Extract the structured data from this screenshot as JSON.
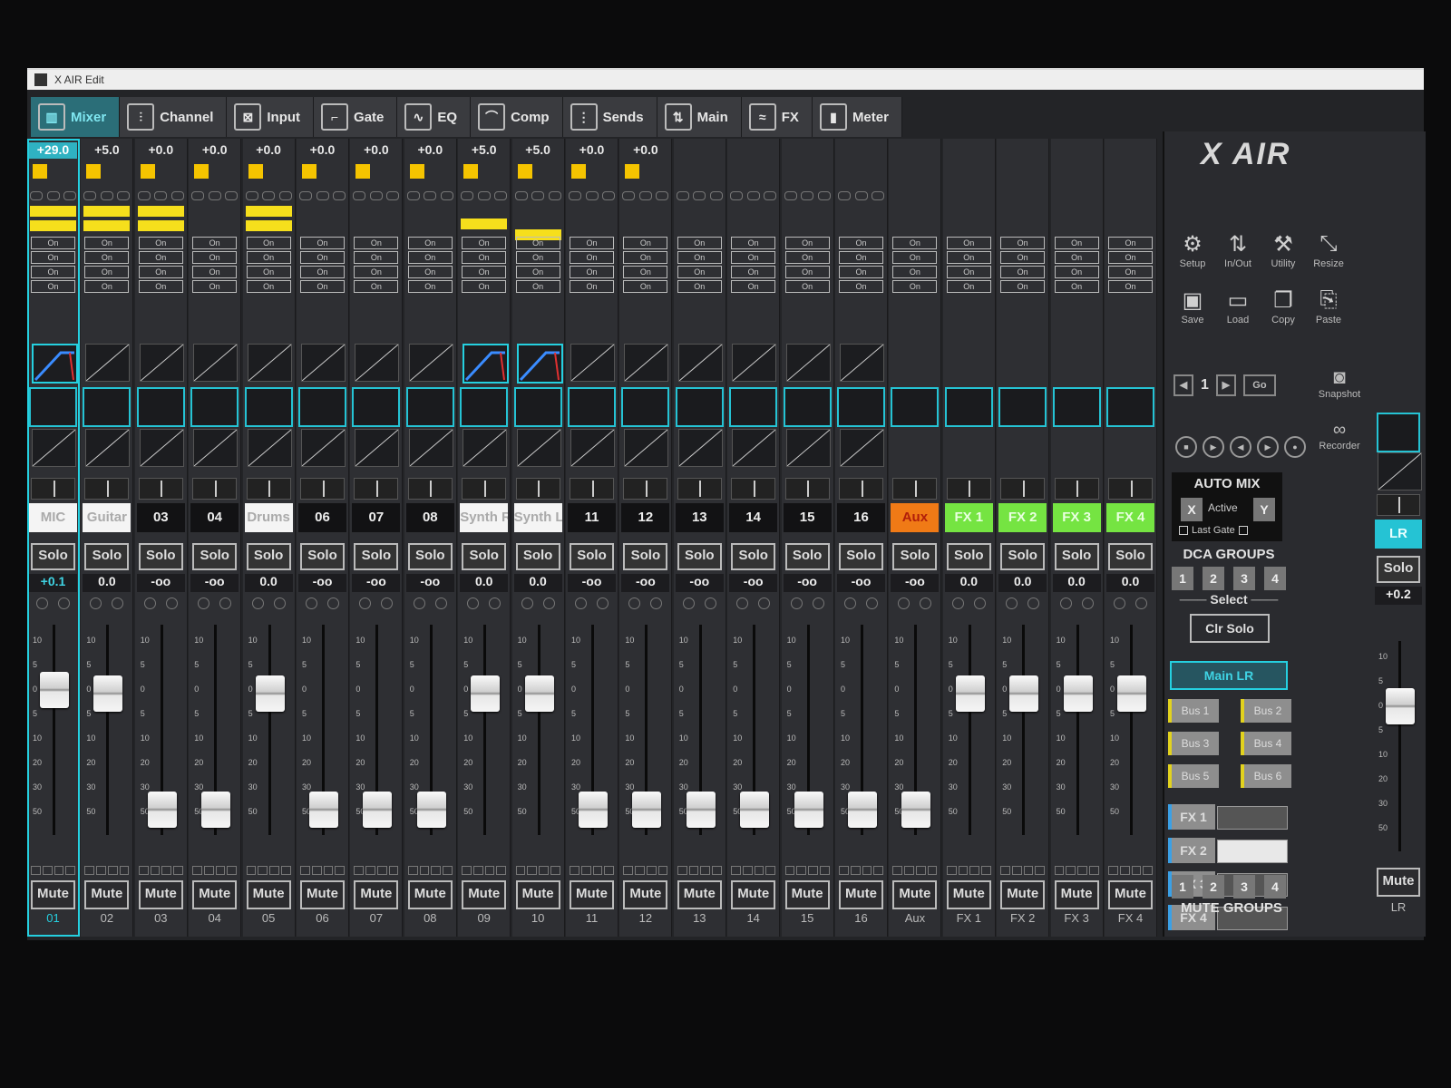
{
  "window": {
    "title": "X AIR Edit"
  },
  "tabs": [
    {
      "label": "Mixer",
      "icon": "mixer-icon",
      "active": true
    },
    {
      "label": "Channel",
      "icon": "channel-icon"
    },
    {
      "label": "Input",
      "icon": "input-icon"
    },
    {
      "label": "Gate",
      "icon": "gate-icon"
    },
    {
      "label": "EQ",
      "icon": "eq-icon"
    },
    {
      "label": "Comp",
      "icon": "comp-icon"
    },
    {
      "label": "Sends",
      "icon": "sends-icon"
    },
    {
      "label": "Main",
      "icon": "main-icon"
    },
    {
      "label": "FX",
      "icon": "fx-icon"
    },
    {
      "label": "Meter",
      "icon": "meter-icon"
    }
  ],
  "on_label": "On",
  "solo_label": "Solo",
  "mute_label": "Mute",
  "scale": [
    "10",
    "5",
    "0",
    "5",
    "10",
    "20",
    "30",
    "50"
  ],
  "channels": [
    {
      "gain": "+29.0",
      "name": "MIC",
      "level": "+0.1",
      "num": "01",
      "fader": 0.74,
      "style": "white",
      "sel": true
    },
    {
      "gain": "+5.0",
      "name": "Guitar",
      "level": "0.0",
      "num": "02",
      "fader": 0.72,
      "style": "white"
    },
    {
      "gain": "+0.0",
      "name": "03",
      "level": "-oo",
      "num": "03",
      "fader": 0.08
    },
    {
      "gain": "+0.0",
      "name": "04",
      "level": "-oo",
      "num": "04",
      "fader": 0.08
    },
    {
      "gain": "+0.0",
      "name": "Drums",
      "level": "0.0",
      "num": "05",
      "fader": 0.72,
      "style": "white"
    },
    {
      "gain": "+0.0",
      "name": "06",
      "level": "-oo",
      "num": "06",
      "fader": 0.08
    },
    {
      "gain": "+0.0",
      "name": "07",
      "level": "-oo",
      "num": "07",
      "fader": 0.08
    },
    {
      "gain": "+0.0",
      "name": "08",
      "level": "-oo",
      "num": "08",
      "fader": 0.08
    },
    {
      "gain": "+5.0",
      "name": "Synth Right",
      "level": "0.0",
      "num": "09",
      "fader": 0.72,
      "style": "white"
    },
    {
      "gain": "+5.0",
      "name": "Synth Left",
      "level": "0.0",
      "num": "10",
      "fader": 0.72,
      "style": "white"
    },
    {
      "gain": "+0.0",
      "name": "11",
      "level": "-oo",
      "num": "11",
      "fader": 0.08
    },
    {
      "gain": "+0.0",
      "name": "12",
      "level": "-oo",
      "num": "12",
      "fader": 0.08
    },
    {
      "gain": "",
      "name": "13",
      "level": "-oo",
      "num": "13",
      "fader": 0.08
    },
    {
      "gain": "",
      "name": "14",
      "level": "-oo",
      "num": "14",
      "fader": 0.08
    },
    {
      "gain": "",
      "name": "15",
      "level": "-oo",
      "num": "15",
      "fader": 0.08
    },
    {
      "gain": "",
      "name": "16",
      "level": "-oo",
      "num": "16",
      "fader": 0.08
    },
    {
      "gain": "",
      "name": "Aux",
      "level": "-oo",
      "num": "Aux",
      "fader": 0.08,
      "style": "orange"
    },
    {
      "gain": "",
      "name": "FX 1",
      "level": "0.0",
      "num": "FX 1",
      "fader": 0.72,
      "style": "green"
    },
    {
      "gain": "",
      "name": "FX 2",
      "level": "0.0",
      "num": "FX 2",
      "fader": 0.72,
      "style": "green"
    },
    {
      "gain": "",
      "name": "FX 3",
      "level": "0.0",
      "num": "FX 3",
      "fader": 0.72,
      "style": "green"
    },
    {
      "gain": "",
      "name": "FX 4",
      "level": "0.0",
      "num": "FX 4",
      "fader": 0.72,
      "style": "green"
    }
  ],
  "right": {
    "logo": "X AIR",
    "tools": [
      {
        "label": "Setup",
        "icon": "gears-icon"
      },
      {
        "label": "In/Out",
        "icon": "in-out-icon"
      },
      {
        "label": "Utility",
        "icon": "wrench-icon"
      },
      {
        "label": "Resize",
        "icon": "resize-icon"
      },
      {
        "label": "Save",
        "icon": "save-icon"
      },
      {
        "label": "Load",
        "icon": "folder-icon"
      },
      {
        "label": "Copy",
        "icon": "copy-icon"
      },
      {
        "label": "Paste",
        "icon": "paste-icon"
      }
    ],
    "snapshot_index": "1",
    "go_label": "Go",
    "snapshot_label": "Snapshot",
    "recorder_label": "Recorder",
    "automix_title": "AUTO MIX",
    "automix_x": "X",
    "automix_y": "Y",
    "automix_active": "Active",
    "last_gate": "Last Gate",
    "dca_title": "DCA GROUPS",
    "dca": [
      "1",
      "2",
      "3",
      "4"
    ],
    "select_label": "Select",
    "clr_solo": "Clr Solo",
    "main_lr": "Main LR",
    "buses": [
      "Bus 1",
      "Bus 2",
      "Bus 3",
      "Bus 4",
      "Bus 5",
      "Bus 6"
    ],
    "fx": [
      "FX 1",
      "FX 2",
      "FX 3",
      "FX 4"
    ],
    "mute_groups_title": "MUTE GROUPS",
    "mute_groups": [
      "1",
      "2",
      "3",
      "4"
    ],
    "lr": {
      "name": "LR",
      "solo": "Solo",
      "level": "+0.2",
      "mute": "Mute",
      "num": "LR",
      "fader": 0.74
    }
  },
  "colors": {
    "accent": "#25d0e0",
    "yellow": "#f6df1c",
    "aux": "#f07a16",
    "fx": "#75e442"
  }
}
